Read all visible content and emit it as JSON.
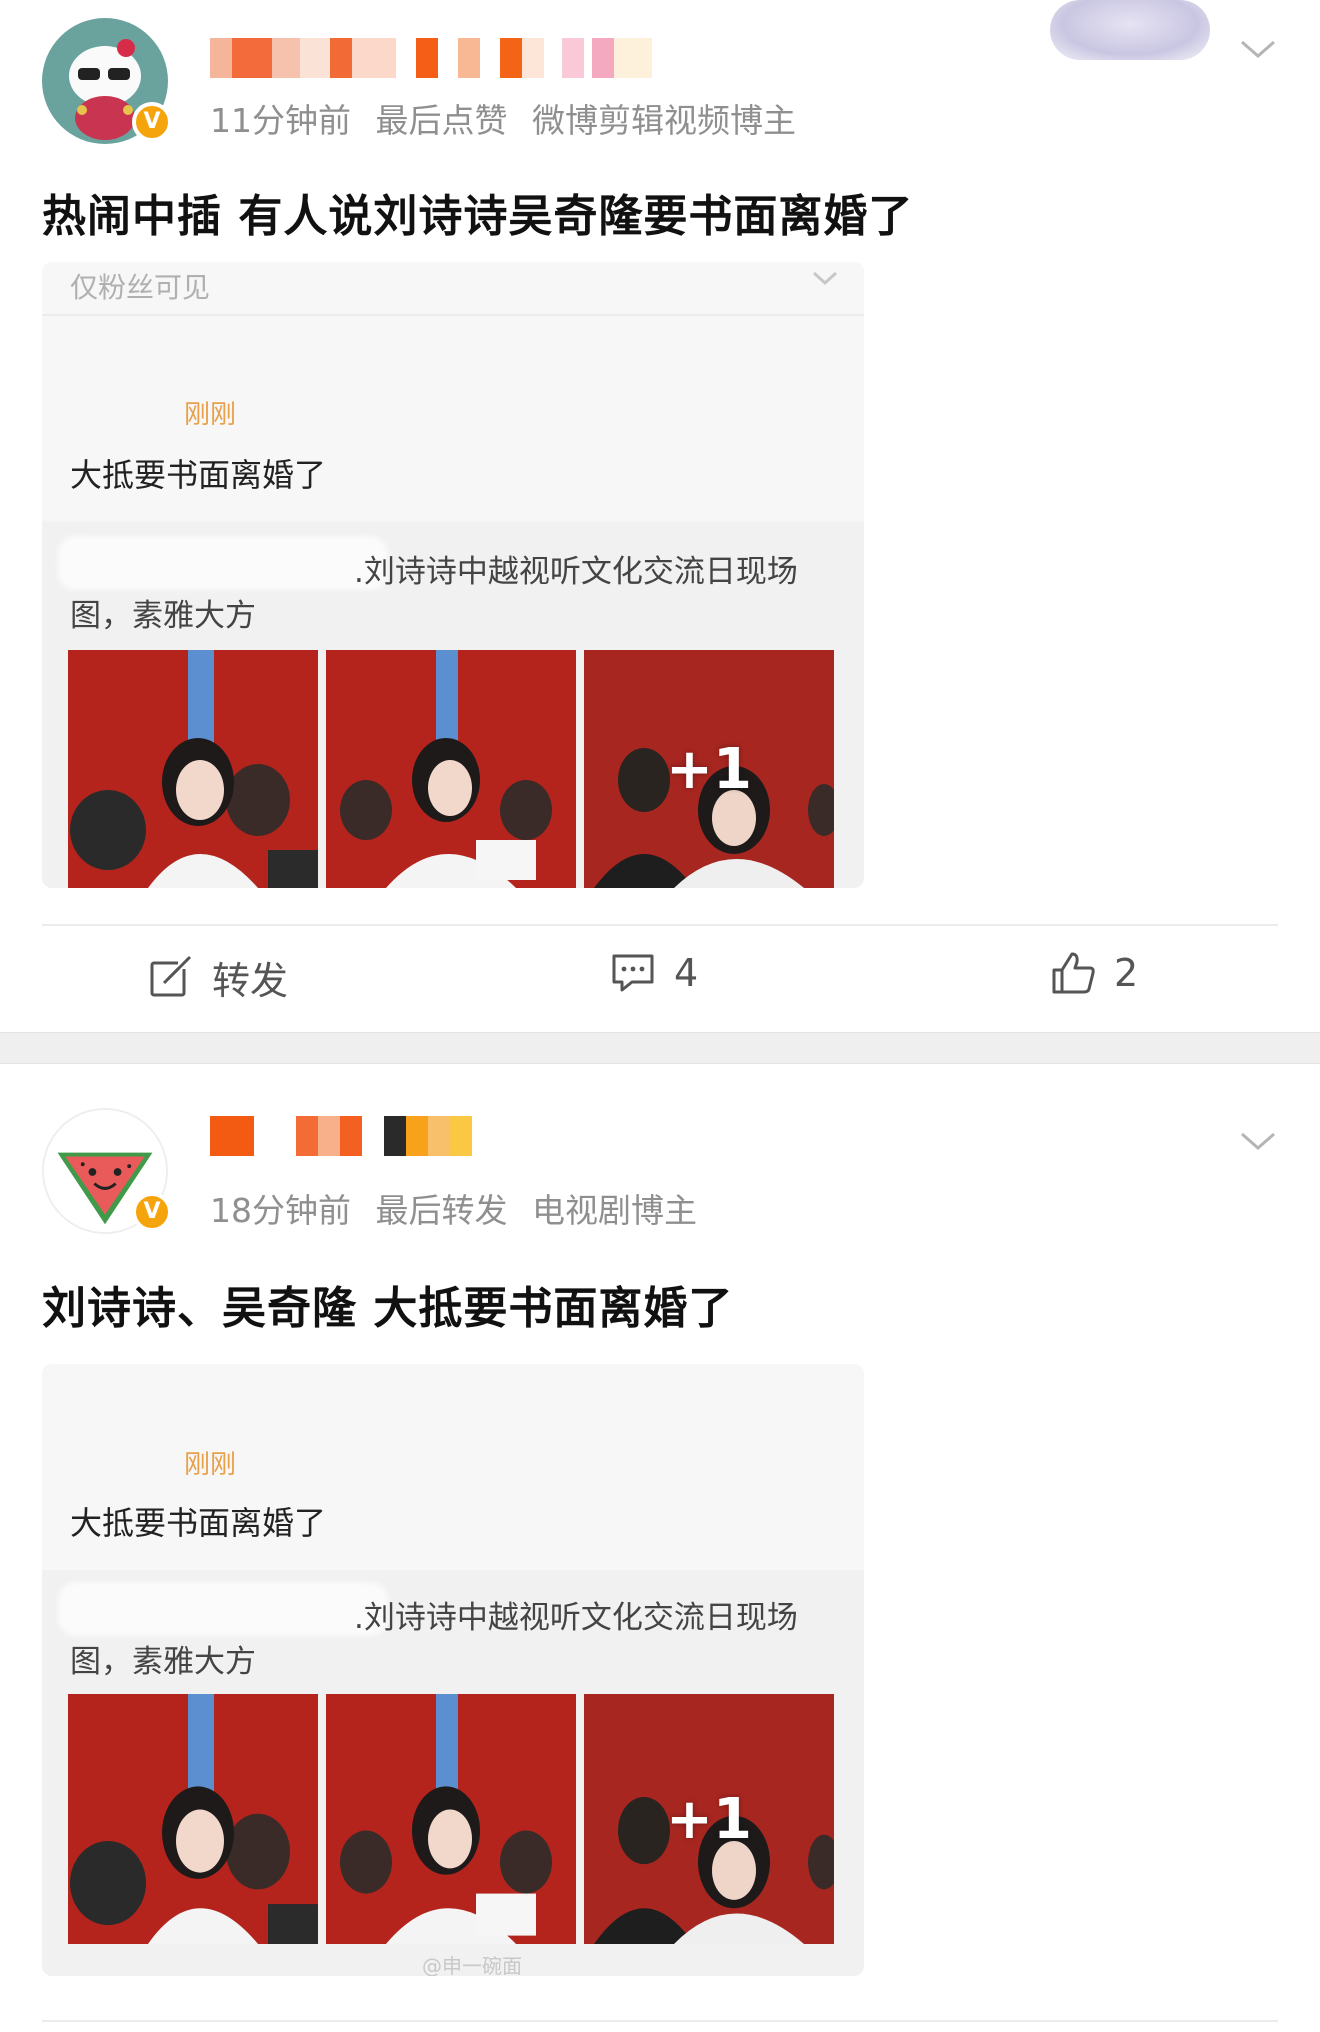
{
  "posts": [
    {
      "username": "",
      "meta": {
        "time": "11分钟前",
        "activity": "最后点赞",
        "role": "微博剪辑视频博主"
      },
      "text": "热闹中插 有人说刘诗诗吴奇隆要书面离婚了",
      "card": {
        "faded_header": "仅粉丝可见",
        "time_label": "刚刚",
        "reply_text": "大抵要书面离婚了",
        "quote_line1": ".刘诗诗中越视听文化交流日现场",
        "quote_line2": "图，素雅大方",
        "more_count": "+1"
      },
      "actions": {
        "repost": "转发",
        "comments": "4",
        "likes": "2"
      }
    },
    {
      "username": "",
      "meta": {
        "time": "18分钟前",
        "activity": "最后转发",
        "role": "电视剧博主"
      },
      "text": "刘诗诗、吴奇隆 大抵要书面离婚了",
      "card": {
        "time_label": "刚刚",
        "reply_text": "大抵要书面离婚了",
        "quote_line1": ".刘诗诗中越视听文化交流日现场",
        "quote_line2": "图，素雅大方",
        "more_count": "+1",
        "watermark": "@申一碗面"
      }
    }
  ],
  "icons": {
    "verified": "verified-badge",
    "chevron": "chevron-down-icon",
    "repost": "repost-icon",
    "comment": "comment-icon",
    "like": "like-icon"
  },
  "colors": {
    "verified": "#f5a40c",
    "time_link": "#e8a04a",
    "meta_gray": "#8f8f8f",
    "photo_red": "#b12d25"
  }
}
